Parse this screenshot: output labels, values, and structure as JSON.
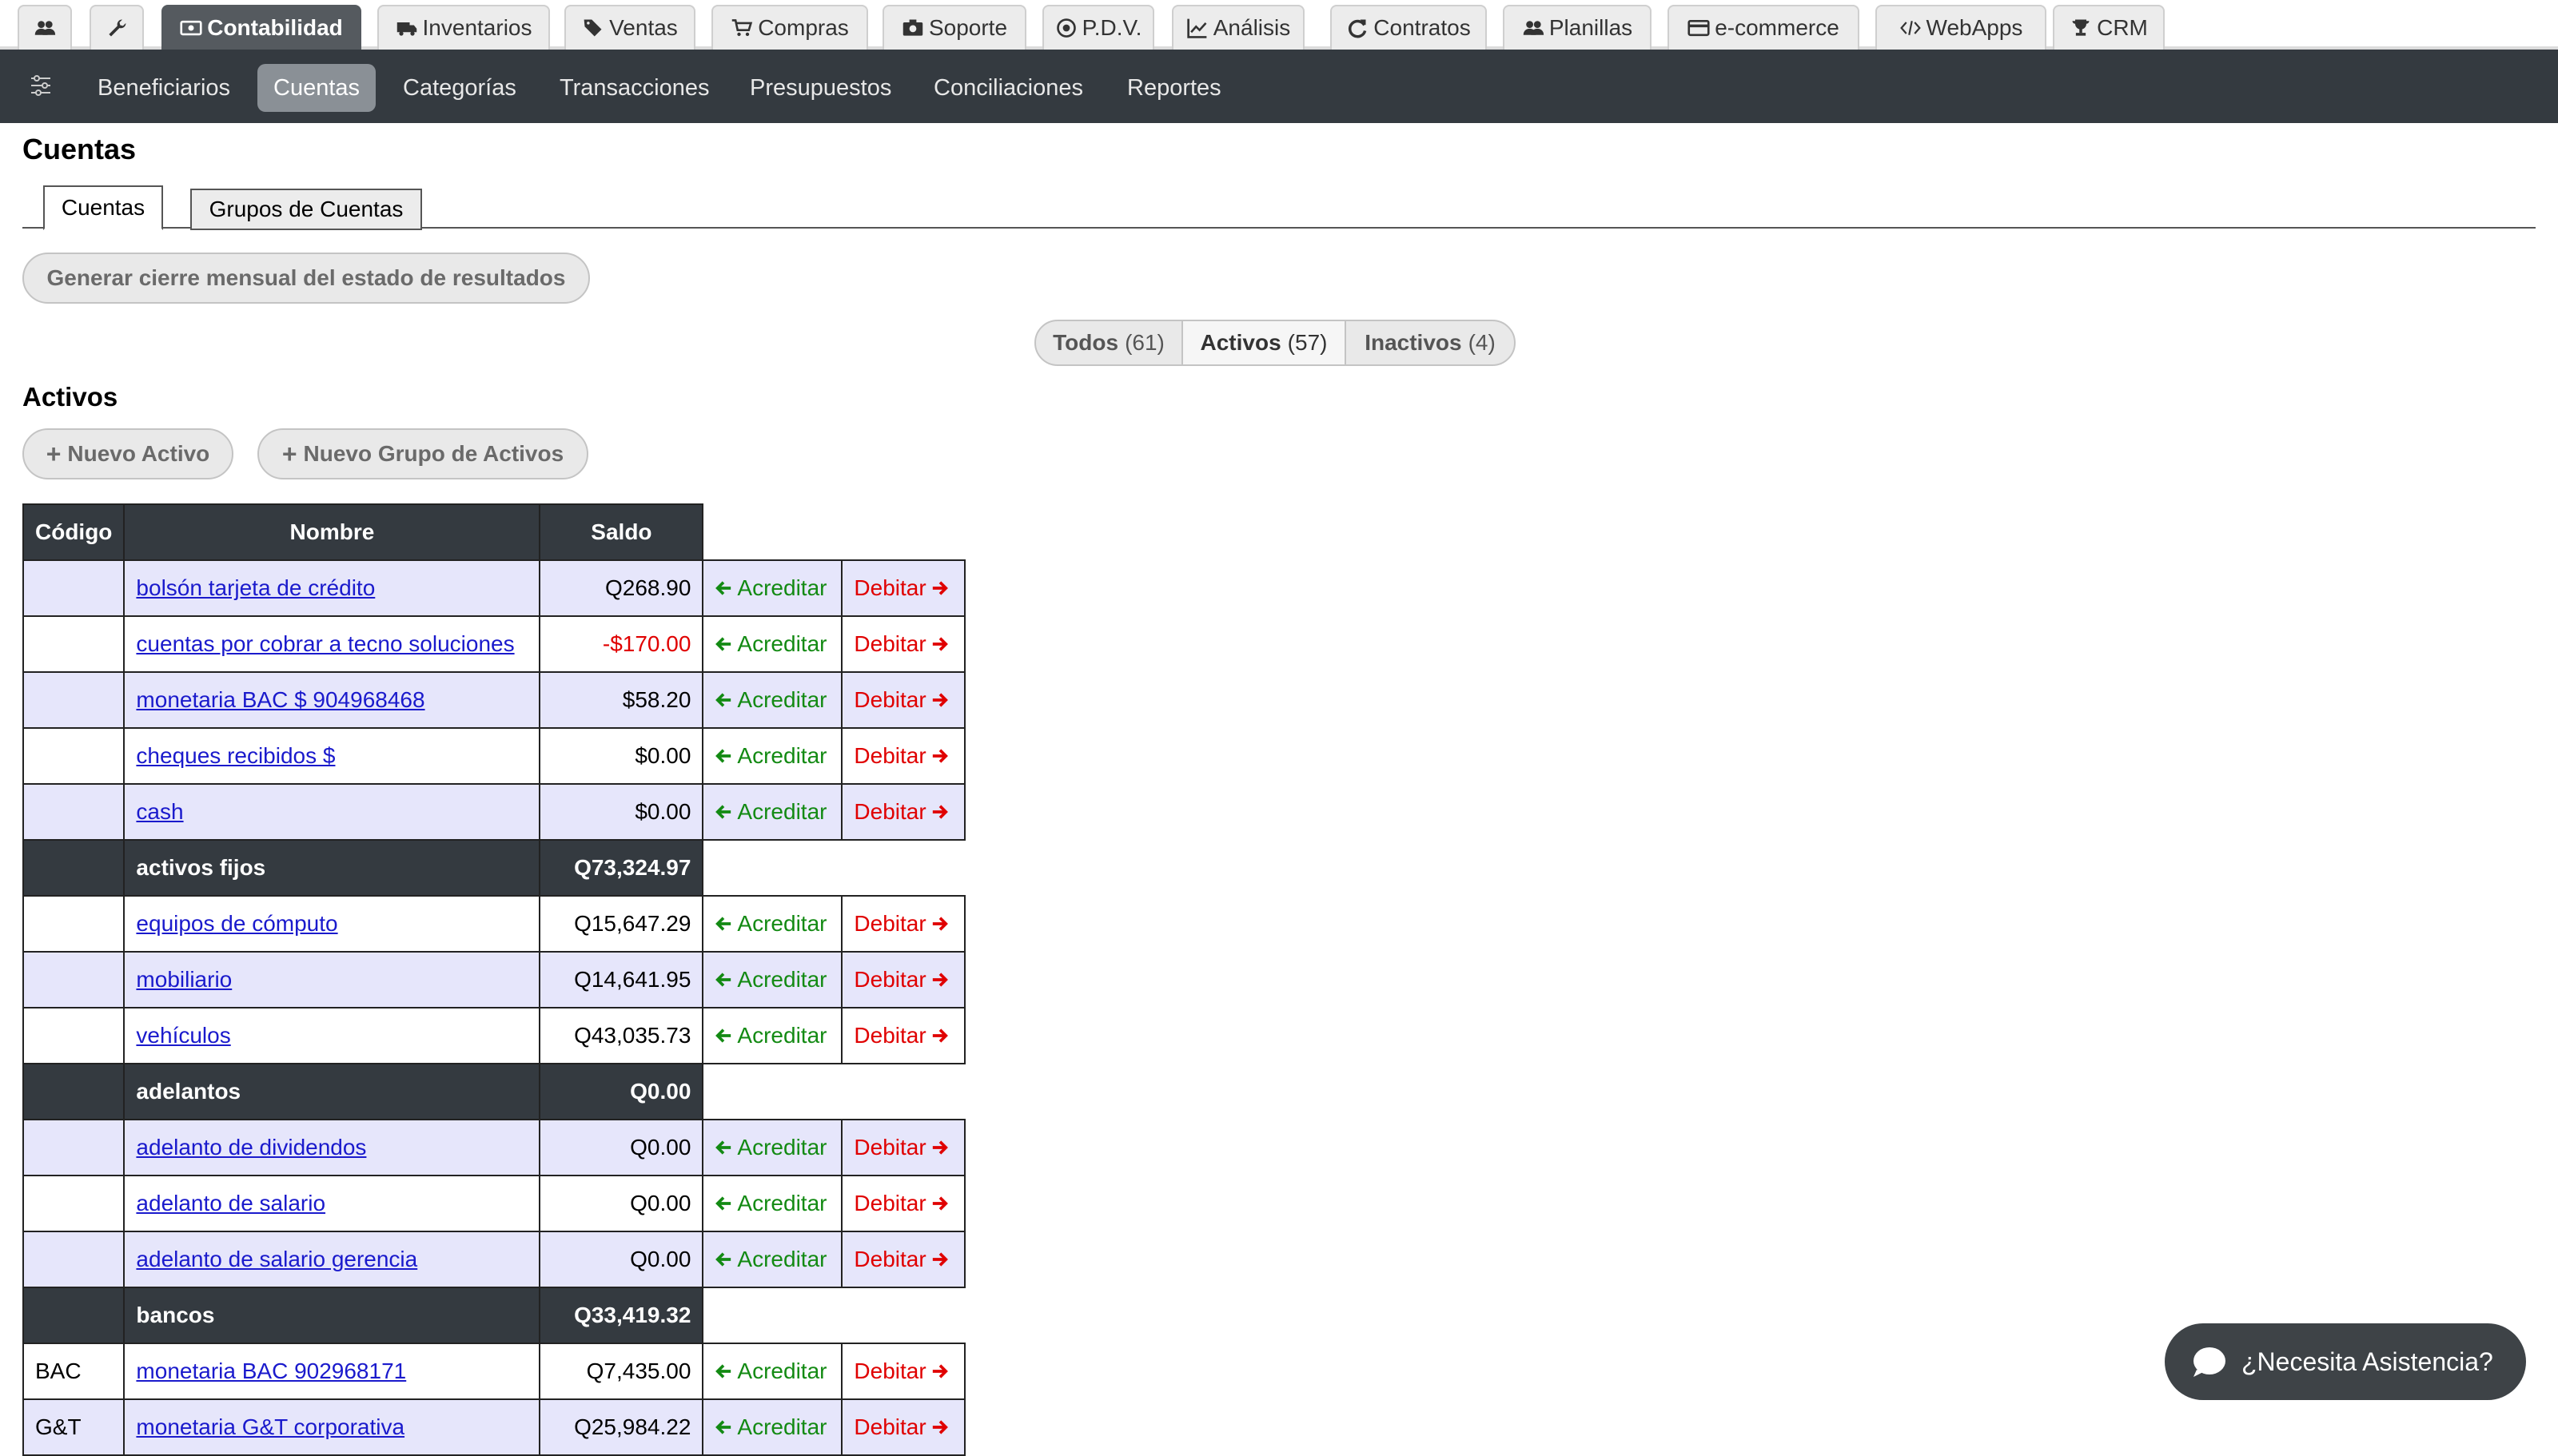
{
  "top_tabs": [
    {
      "label": "",
      "icon": "users-icon"
    },
    {
      "label": "",
      "icon": "wrench-icon"
    },
    {
      "label": "Contabilidad",
      "icon": "money-icon",
      "active": true
    },
    {
      "label": "Inventarios",
      "icon": "truck-icon"
    },
    {
      "label": "Ventas",
      "icon": "tags-icon"
    },
    {
      "label": "Compras",
      "icon": "cart-icon"
    },
    {
      "label": "Soporte",
      "icon": "camera-icon"
    },
    {
      "label": "P.D.V.",
      "icon": "target-icon"
    },
    {
      "label": "Análisis",
      "icon": "line-chart-icon"
    },
    {
      "label": "Contratos",
      "icon": "refresh-icon"
    },
    {
      "label": "Planillas",
      "icon": "users-icon"
    },
    {
      "label": "e-commerce",
      "icon": "credit-card-icon"
    },
    {
      "label": "WebApps",
      "icon": "code-icon"
    },
    {
      "label": "CRM",
      "icon": "trophy-icon"
    }
  ],
  "sub_nav": {
    "items": [
      "Beneficiarios",
      "Cuentas",
      "Categorías",
      "Transacciones",
      "Presupuestos",
      "Conciliaciones",
      "Reportes"
    ],
    "active": "Cuentas"
  },
  "page_title": "Cuentas",
  "inner_tabs": [
    "Cuentas",
    "Grupos de Cuentas"
  ],
  "close_month_button": "Generar cierre mensual del estado de resultados",
  "filters": [
    {
      "label": "Todos",
      "count": "(61)"
    },
    {
      "label": "Activos",
      "count": "(57)"
    },
    {
      "label": "Inactivos",
      "count": "(4)"
    }
  ],
  "section_title": "Activos",
  "new_asset_button": "Nuevo Activo",
  "new_asset_group_button": "Nuevo Grupo de Activos",
  "table": {
    "headers": [
      "Código",
      "Nombre",
      "Saldo"
    ],
    "credit_label": "Acreditar",
    "debit_label": "Debitar",
    "rows": [
      {
        "type": "account",
        "code": "",
        "name": "bolsón tarjeta de crédito",
        "balance": "Q268.90"
      },
      {
        "type": "account",
        "code": "",
        "name": "cuentas por cobrar a tecno soluciones",
        "balance": "-$170.00",
        "negative": true
      },
      {
        "type": "account",
        "code": "",
        "name": "monetaria BAC $ 904968468",
        "balance": "$58.20"
      },
      {
        "type": "account",
        "code": "",
        "name": "cheques recibidos $",
        "balance": "$0.00"
      },
      {
        "type": "account",
        "code": "",
        "name": "cash",
        "balance": "$0.00"
      },
      {
        "type": "group",
        "name": "activos fijos",
        "balance": "Q73,324.97"
      },
      {
        "type": "account",
        "code": "",
        "name": "equipos de cómputo",
        "balance": "Q15,647.29"
      },
      {
        "type": "account",
        "code": "",
        "name": "mobiliario",
        "balance": "Q14,641.95"
      },
      {
        "type": "account",
        "code": "",
        "name": "vehículos",
        "balance": "Q43,035.73"
      },
      {
        "type": "group",
        "name": "adelantos",
        "balance": "Q0.00"
      },
      {
        "type": "account",
        "code": "",
        "name": "adelanto de dividendos",
        "balance": "Q0.00"
      },
      {
        "type": "account",
        "code": "",
        "name": "adelanto de salario",
        "balance": "Q0.00"
      },
      {
        "type": "account",
        "code": "",
        "name": "adelanto de salario gerencia",
        "balance": "Q0.00"
      },
      {
        "type": "group",
        "name": "bancos",
        "balance": "Q33,419.32"
      },
      {
        "type": "account",
        "code": "BAC",
        "name": "monetaria BAC 902968171",
        "balance": "Q7,435.00"
      },
      {
        "type": "account",
        "code": "G&T",
        "name": "monetaria G&T corporativa",
        "balance": "Q25,984.22"
      }
    ]
  },
  "assistance_button": "¿Necesita Asistencia?",
  "colors": {
    "nav_dark": "#343a40",
    "row_alt": "#e6e6fb",
    "credit_green": "#138a13",
    "debit_red": "#e00000",
    "link_blue": "#1a1acc"
  }
}
